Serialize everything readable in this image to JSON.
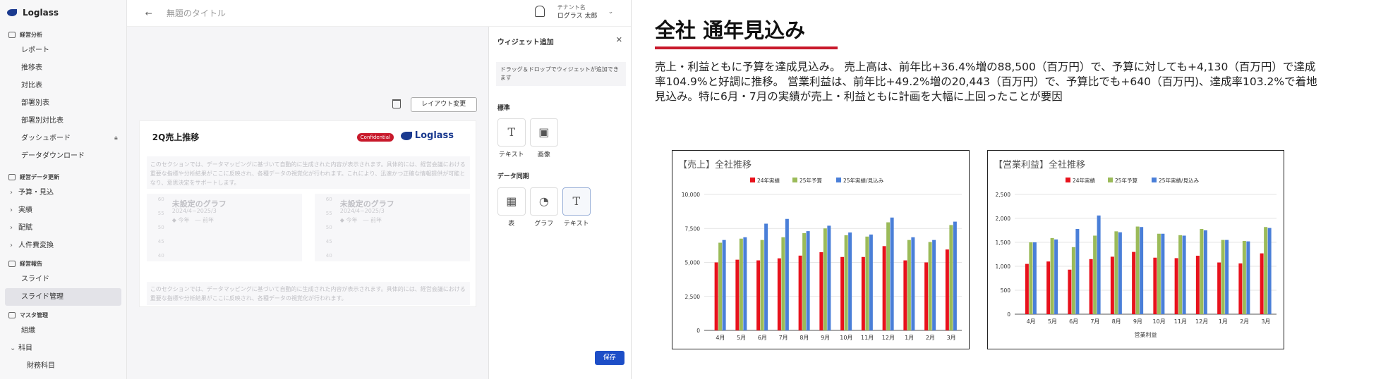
{
  "app": {
    "brand": "Loglass",
    "sidebar": {
      "sections": [
        {
          "label": "経営分析",
          "items": [
            "レポート",
            "推移表",
            "対比表",
            "部署別表",
            "部署別対比表",
            "ダッシュボード",
            "データダウンロード"
          ]
        },
        {
          "label": "経営データ更新",
          "items": [
            "予算・見込",
            "実績",
            "配賦",
            "人件費変換"
          ]
        },
        {
          "label": "経営報告",
          "items": [
            "スライド",
            "スライド管理"
          ]
        },
        {
          "label": "マスタ管理",
          "items": [
            "組織",
            "科目",
            "財務科目"
          ]
        }
      ],
      "active_item": "スライド管理"
    },
    "topbar": {
      "back_icon": "arrow-left-icon",
      "title": "無題のタイトル",
      "tenant_label": "テナント名",
      "user_name": "ログラス 太郎"
    },
    "canvas": {
      "layout_button": "レイアウト変更",
      "slide_title": "2Q売上推移",
      "badge": "Confidential",
      "logo_text": "Loglass",
      "text1": "このセクションでは、データマッピングに基づいて自動的に生成された内容が表示されます。具体的には、経営会議における重要な指標や分析結果がここに反映され、各種データの視覚化が行われます。これにより、迅速かつ正確な情報提供が可能となり、意思決定をサポートします。",
      "mini_charts": [
        {
          "title": "未設定のグラフ",
          "subtitle": "2024/4~2025/3",
          "legend": "◆ 今年　― 前年",
          "axis": [
            "60",
            "55",
            "50",
            "45",
            "40"
          ]
        },
        {
          "title": "未設定のグラフ",
          "subtitle": "2024/4~2025/3",
          "legend": "◆ 今年　― 前年",
          "axis": [
            "60",
            "55",
            "50",
            "45",
            "40"
          ]
        }
      ],
      "text2": "このセクションでは、データマッピングに基づいて自動的に生成された内容が表示されます。具体的には、経営会議における重要な指標や分析結果がここに反映され、各種データの視覚化が行われます。"
    },
    "panel": {
      "title": "ウィジェット追加",
      "help": "ドラッグ＆ドロップでウィジェットが追加できます",
      "standard_label": "標準",
      "standard": [
        {
          "label": "テキスト",
          "icon": "text-icon"
        },
        {
          "label": "画像",
          "icon": "image-icon"
        }
      ],
      "data_label": "データ同期",
      "data": [
        {
          "label": "表",
          "icon": "table-icon"
        },
        {
          "label": "グラフ",
          "icon": "pie-chart-icon"
        },
        {
          "label": "テキスト",
          "icon": "text-icon"
        }
      ],
      "save": "保存"
    }
  },
  "slide": {
    "title": "全社 通年見込み",
    "body": "売上・利益ともに予算を達成見込み。 売上高は、前年比+36.4%増の88,500（百万円）で、予算に対しても+4,130（百万円）で達成率104.9%と好調に推移。 営業利益は、前年比+49.2%増の20,443（百万円）で、予算比でも+640（百万円)、達成率103.2%で着地見込み。特に6月・7月の実績が売上・利益ともに計画を大幅に上回ったことが要因",
    "accent": "#c8192b"
  },
  "chart_data": [
    {
      "type": "bar",
      "title": "【売上】全社推移",
      "xlabel": "",
      "categories": [
        "4月",
        "5月",
        "6月",
        "7月",
        "8月",
        "9月",
        "10月",
        "11月",
        "12月",
        "1月",
        "2月",
        "3月"
      ],
      "ylim": [
        0,
        10000
      ],
      "yticks": [
        "0",
        "2,500",
        "5,000",
        "7,500",
        "10,000"
      ],
      "legend_position": "top",
      "series": [
        {
          "name": "24年実績",
          "color": "#e8121c",
          "values": [
            5000,
            5200,
            5150,
            5300,
            5500,
            5750,
            5400,
            5400,
            6200,
            5150,
            5000,
            5950
          ]
        },
        {
          "name": "25年予算",
          "color": "#9bbb59",
          "values": [
            6450,
            6750,
            6650,
            6850,
            7150,
            7500,
            7000,
            6900,
            7950,
            6650,
            6500,
            7750
          ]
        },
        {
          "name": "25年実績/見込み",
          "color": "#4a7fd8",
          "values": [
            6650,
            6850,
            7850,
            8200,
            7300,
            7700,
            7200,
            7050,
            8300,
            6850,
            6650,
            8000
          ]
        }
      ]
    },
    {
      "type": "bar",
      "title": "【営業利益】全社推移",
      "xlabel": "営業利益",
      "categories": [
        "4月",
        "5月",
        "6月",
        "7月",
        "8月",
        "9月",
        "10月",
        "11月",
        "12月",
        "1月",
        "2月",
        "3月"
      ],
      "ylim": [
        0,
        2500
      ],
      "yticks": [
        "0",
        "500",
        "1,000",
        "1,500",
        "2,000",
        "2,500"
      ],
      "legend_position": "top",
      "series": [
        {
          "name": "24年実績",
          "color": "#e8121c",
          "values": [
            1050,
            1100,
            930,
            1150,
            1200,
            1300,
            1180,
            1170,
            1220,
            1080,
            1060,
            1270
          ]
        },
        {
          "name": "25年予算",
          "color": "#9bbb59",
          "values": [
            1500,
            1590,
            1400,
            1640,
            1730,
            1830,
            1680,
            1650,
            1780,
            1550,
            1530,
            1820
          ]
        },
        {
          "name": "25年実績/見込み",
          "color": "#4a7fd8",
          "values": [
            1500,
            1560,
            1780,
            2060,
            1710,
            1820,
            1680,
            1640,
            1750,
            1550,
            1520,
            1800
          ]
        }
      ]
    }
  ]
}
